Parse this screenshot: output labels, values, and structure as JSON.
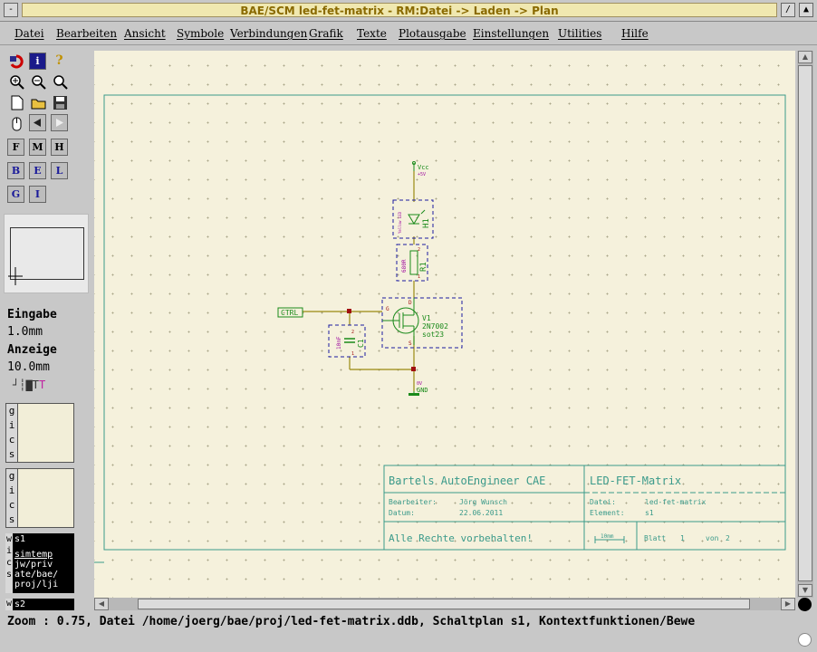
{
  "window": {
    "title": "BAE/SCM led-fet-matrix - RM:Datei -> Laden -> Plan",
    "btn_left": "-",
    "btn_min": "/",
    "btn_max": "▲"
  },
  "menu": [
    "Datei",
    "Bearbeiten",
    "Ansicht",
    "Symbole",
    "Verbindungen",
    "Grafik",
    "Texte",
    "Plotausgabe",
    "Einstellungen",
    "Utilities",
    "Hilfe"
  ],
  "toolbox": {
    "letters": [
      "F",
      "M",
      "H",
      "B",
      "E",
      "L",
      "G",
      "I"
    ]
  },
  "info": {
    "eingabe_label": "Eingabe",
    "eingabe_value": "1.0mm",
    "anzeige_label": "Anzeige",
    "anzeige_value": "10.0mm",
    "mode_icons": "┘┆▇TT"
  },
  "gics_letters": [
    "g",
    "i",
    "c",
    "s"
  ],
  "windows_list": {
    "w1": "s1",
    "w1_items": [
      "simtemp",
      "jw/priv",
      "ate/bae/",
      "proj/lji"
    ],
    "w1_letters": [
      "w",
      "i",
      "c",
      "s"
    ],
    "w2_letter": "w",
    "w2": "s2"
  },
  "schematic": {
    "vcc": "Vcc",
    "vcc_v": "+5V",
    "h1": "H1",
    "h1_val": "Yellow LED",
    "r1": "R1",
    "r1_val": "680R",
    "q1": "V1",
    "q1_val": "2N7002",
    "q1_pkg": "sot23",
    "c1": "C1",
    "c1_val": "10nF",
    "ctrl": "CTRL",
    "gnd": "GND",
    "gnd_v": "0V",
    "pin_g": "G",
    "pin_d": "D",
    "pin_s": "S",
    "pin1": "1",
    "pin2": "2"
  },
  "titleblock": {
    "company": "Bartels AutoEngineer CAE",
    "project": "LED-FET-Matrix",
    "bearbeiter_label": "Bearbeiter:",
    "bearbeiter": "Jörg Wunsch",
    "datum_label": "Datum:",
    "datum": "22.06.2011",
    "datei_label": "Datei:",
    "datei": "led-fet-matrix",
    "element_label": "Element:",
    "element": "s1",
    "rights": "Alle Rechte vorbehalten!",
    "scale": "10mm",
    "blatt_label": "Blatt",
    "blatt": "1",
    "von_label": "von",
    "von": "2"
  },
  "status": {
    "text": "Zoom : 0.75, Datei /home/joerg/bae/proj/led-fet-matrix.ddb, Schaltplan s1, Kontextfunktionen/Bewe"
  },
  "colors": {
    "canvas_bg": "#f5f1dc",
    "frame": "#3a9a8a",
    "wire": "#9a8a10",
    "symbol": "#1a8a1a",
    "part_box": "#1a1aa0",
    "attr": "#a010a0",
    "junction": "#a01010"
  }
}
